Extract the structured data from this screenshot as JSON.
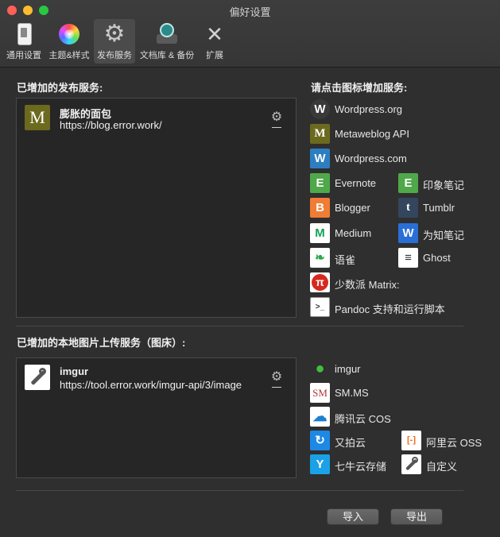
{
  "window": {
    "title": "偏好设置"
  },
  "tabs": [
    {
      "label": "通用设置",
      "icon": "switch-icon"
    },
    {
      "label": "主题&样式",
      "icon": "color-wheel-icon"
    },
    {
      "label": "发布服务",
      "icon": "gear-icon",
      "active": true
    },
    {
      "label": "文档库 & 备份",
      "icon": "time-machine-icon"
    },
    {
      "label": "扩展",
      "icon": "tools-icon"
    }
  ],
  "publish": {
    "title": "已增加的发布服务:",
    "services": [
      {
        "name": "膨胀的面包",
        "url": "https://blog.error.work/",
        "icon": "metaweblog-icon",
        "icon_text": "M"
      }
    ]
  },
  "add_publish": {
    "title": "请点击图标增加服务:",
    "items": [
      {
        "label": "Wordpress.org",
        "icon": "wordpress-icon",
        "glyph": "W",
        "color": "#3a3a3a"
      },
      {
        "label": "Metaweblog API",
        "icon": "metaweblog-icon",
        "glyph": "M",
        "color": "#6b6a1e"
      },
      {
        "label": "Wordpress.com",
        "icon": "wordpress-com-icon",
        "glyph": "W",
        "color": "#2d7ec1"
      },
      {
        "label": "Evernote",
        "icon": "evernote-icon",
        "glyph": "E",
        "color": "#4fa84a"
      },
      {
        "label": "印象笔记",
        "icon": "yinxiang-icon",
        "glyph": "E",
        "color": "#4fa84a"
      },
      {
        "label": "Blogger",
        "icon": "blogger-icon",
        "glyph": "B",
        "color": "#f07d33"
      },
      {
        "label": "Tumblr",
        "icon": "tumblr-icon",
        "glyph": "t",
        "color": "#34465d"
      },
      {
        "label": "Medium",
        "icon": "medium-icon",
        "glyph": "M",
        "color": "#ffffff"
      },
      {
        "label": "为知笔记",
        "icon": "wiz-icon",
        "glyph": "W",
        "color": "#2a6fd6"
      },
      {
        "label": "语雀",
        "icon": "yuque-icon",
        "glyph": "❧",
        "color": "#ffffff"
      },
      {
        "label": "Ghost",
        "icon": "ghost-icon",
        "glyph": "≡",
        "color": "#ffffff"
      },
      {
        "label": "少数派 Matrix:",
        "icon": "sspai-icon",
        "glyph": "π",
        "color": "#d7281f"
      },
      {
        "label": "Pandoc 支持和运行脚本",
        "icon": "terminal-icon",
        "glyph": ">_",
        "color": "#ffffff"
      }
    ]
  },
  "image": {
    "title": "已增加的本地图片上传服务（图床）:",
    "services": [
      {
        "name": "imgur",
        "url": "https://tool.error.work/imgur-api/3/image",
        "icon": "wrench-icon"
      }
    ]
  },
  "add_image": {
    "items": [
      {
        "label": "imgur",
        "icon": "imgur-icon",
        "glyph": "●",
        "color": "#2f2f2f"
      },
      {
        "label": "SM.MS",
        "icon": "smms-icon",
        "glyph": "SM",
        "color": "#ffffff"
      },
      {
        "label": "腾讯云 COS",
        "icon": "tencent-cloud-icon",
        "glyph": "☁",
        "color": "#ffffff"
      },
      {
        "label": "又拍云",
        "icon": "upyun-icon",
        "glyph": "↻",
        "color": "#1e88e5"
      },
      {
        "label": "阿里云 OSS",
        "icon": "aliyun-icon",
        "glyph": "[-]",
        "color": "#ffffff"
      },
      {
        "label": "七牛云存储",
        "icon": "qiniu-icon",
        "glyph": "Y",
        "color": "#1aa1e6"
      },
      {
        "label": "自定义",
        "icon": "wrench-icon",
        "glyph": "🔧",
        "color": "#ffffff"
      }
    ]
  },
  "buttons": {
    "import": "导入",
    "export": "导出"
  }
}
